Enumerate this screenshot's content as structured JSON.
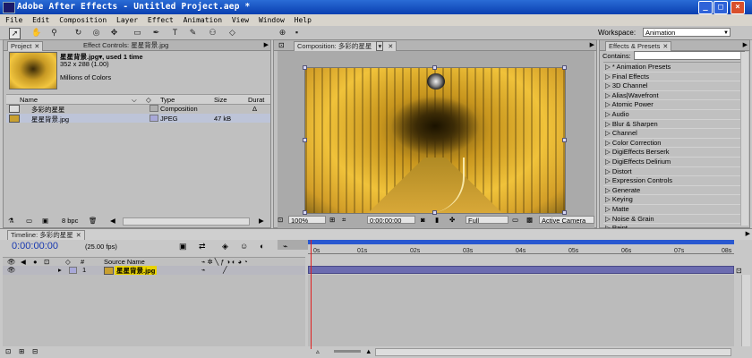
{
  "window": {
    "title": "Adobe After Effects - Untitled Project.aep *",
    "min": "_",
    "max": "□",
    "close": "×"
  },
  "menu": [
    "File",
    "Edit",
    "Composition",
    "Layer",
    "Effect",
    "Animation",
    "View",
    "Window",
    "Help"
  ],
  "toolbar": {
    "workspace_label": "Workspace:",
    "workspace_value": "Animation"
  },
  "project": {
    "tab_project": "Project",
    "tab_effect_controls": "Effect Controls: 星星背景.jpg",
    "selected_name": "星星背景.jpg▾, used 1 time",
    "selected_dims": "352 x 288 (1.00)",
    "selected_colors": "Millions of Colors",
    "columns": {
      "name": "Name",
      "type": "Type",
      "size": "Size",
      "duration": "Durat"
    },
    "items": [
      {
        "name": "多彩的星星",
        "type": "Composition",
        "size": "",
        "duration": "Δ"
      },
      {
        "name": "星星背景.jpg",
        "type": "JPEG",
        "size": "47 kB",
        "duration": ""
      }
    ],
    "bpc": "8 bpc",
    "colors": {
      "comp_swatch": "#b0b0b0",
      "jpeg_swatch": "#a8a8d8"
    }
  },
  "composition": {
    "tab": "Composition: 多彩的星星",
    "zoom": "100%",
    "time": "0:00:00:00",
    "resolution": "Full",
    "camera": "Active Camera"
  },
  "effects": {
    "tab": "Effects & Presets",
    "contains_label": "Contains:",
    "items": [
      "* Animation Presets",
      "Final Effects",
      "3D Channel",
      "Alias|Wavefront",
      "Atomic Power",
      "Audio",
      "Blur & Sharpen",
      "Channel",
      "Color Correction",
      "DigiEffects Berserk",
      "DigiEffects Delirium",
      "Distort",
      "Expression Controls",
      "Generate",
      "Keying",
      "Matte",
      "Noise & Grain",
      "Paint"
    ]
  },
  "timeline": {
    "tab": "Timeline: 多彩的星星",
    "timecode": "0:00:00:00",
    "fps": "(25.00 fps)",
    "col_num": "#",
    "col_source": "Source Name",
    "layer_num": "1",
    "layer_name": "星星背景.jpg",
    "ticks": [
      "0s",
      "01s",
      "02s",
      "03s",
      "04s",
      "05s",
      "06s",
      "07s",
      "08s"
    ],
    "colors": {
      "layer_bar": "#6c6cb0",
      "work_area": "#2958d0",
      "playhead": "#e02020"
    }
  }
}
